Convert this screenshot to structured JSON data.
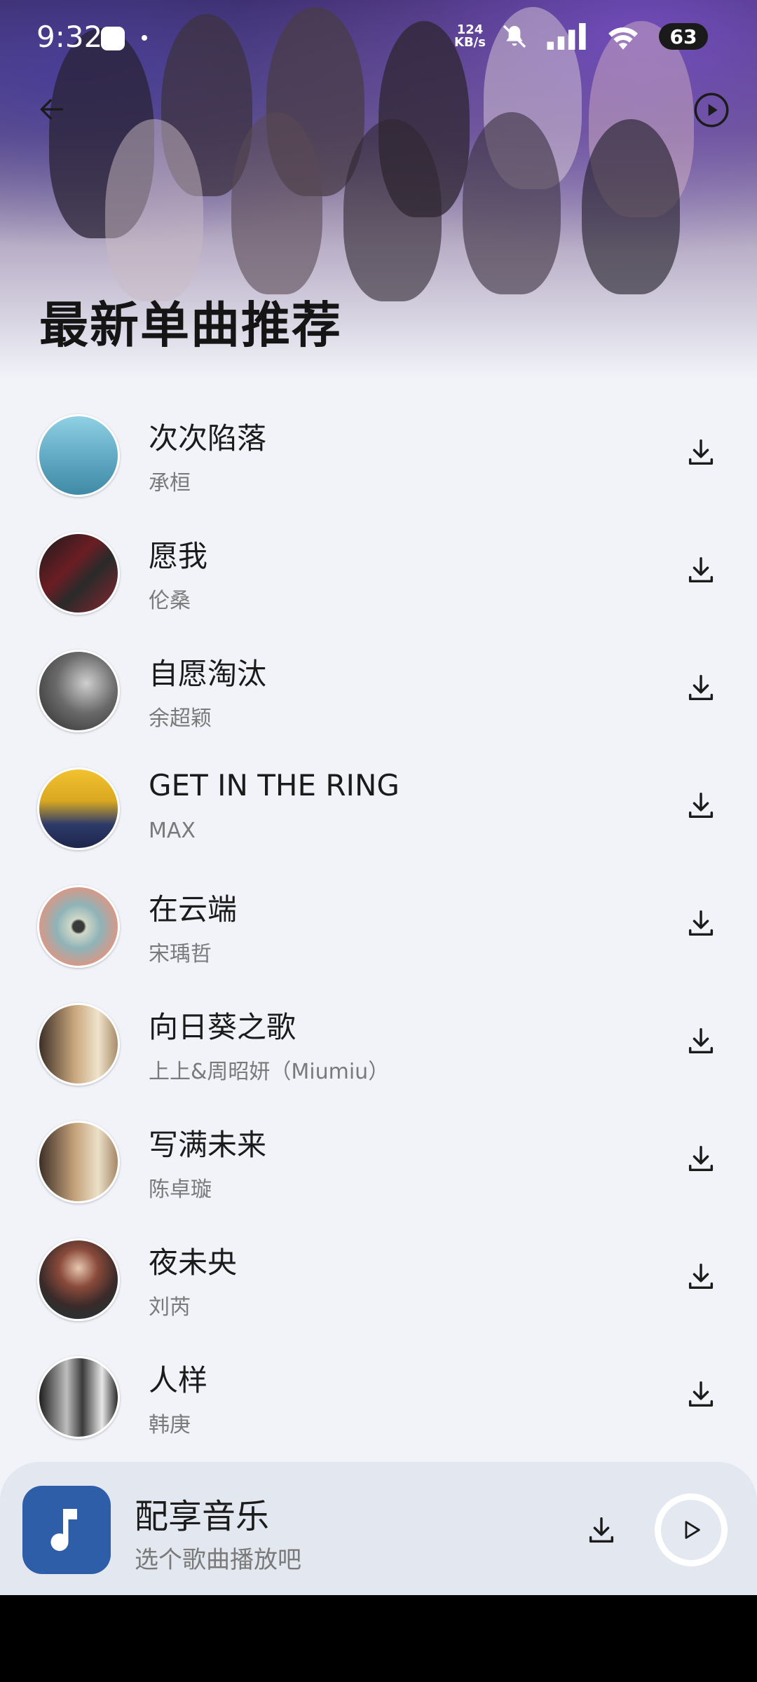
{
  "status_bar": {
    "time": "9:32",
    "net_speed_value": "124",
    "net_speed_unit": "KB/s",
    "battery": "63"
  },
  "header": {
    "title": "最新单曲推荐",
    "back_icon": "arrow-left-icon",
    "play_all_icon": "play-circle-icon"
  },
  "songs": [
    {
      "title": "次次陷落",
      "artist": "承桓",
      "cover_color": "#5fa7c2"
    },
    {
      "title": "愿我",
      "artist": "伦桑",
      "cover_color": "#6b1e24"
    },
    {
      "title": "自愿淘汰",
      "artist": "余超颖",
      "cover_color": "#555555"
    },
    {
      "title": "GET IN THE RING",
      "artist": "MAX",
      "cover_color": "#d9a820"
    },
    {
      "title": "在云端",
      "artist": "宋瑀哲",
      "cover_color": "#8fb3b8"
    },
    {
      "title": "向日葵之歌",
      "artist": "上上&周昭妍（Miumiu）",
      "cover_color": "#c9a77d"
    },
    {
      "title": "写满未来",
      "artist": "陈卓璇",
      "cover_color": "#c4a27a"
    },
    {
      "title": "夜未央",
      "artist": "刘芮",
      "cover_color": "#3a2a2a"
    },
    {
      "title": "人样",
      "artist": "韩庚",
      "cover_color": "#8a8a8a"
    }
  ],
  "mini_player": {
    "title": "配享音乐",
    "subtitle": "选个歌曲播放吧",
    "logo_icon": "music-note-icon",
    "logo_color": "#2f5ea8"
  },
  "colors": {
    "background": "#f1f3f9",
    "title_text": "#1b1b1b",
    "secondary_text": "#7a7a7a"
  }
}
